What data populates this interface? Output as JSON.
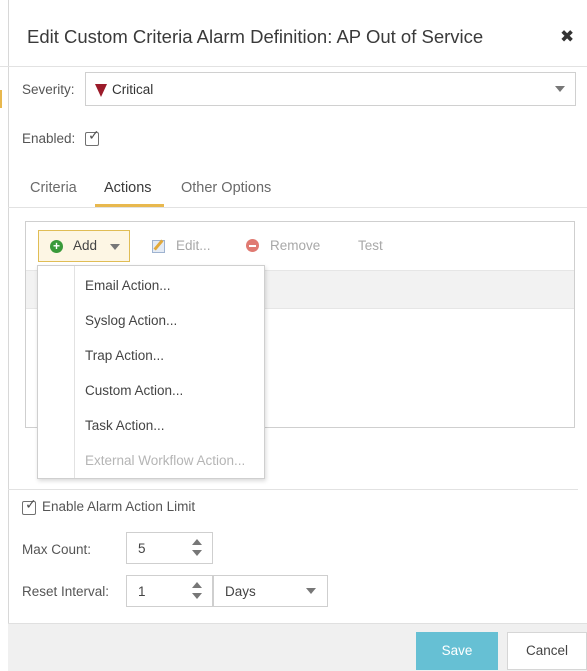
{
  "dialog": {
    "title": "Edit Custom Criteria Alarm Definition: AP Out of Service",
    "close_glyph": "✖"
  },
  "severity": {
    "label": "Severity:",
    "value": "Critical",
    "color": "#9b1b2a"
  },
  "enabled": {
    "label": "Enabled:",
    "checked": true
  },
  "tabs": [
    {
      "label": "Criteria",
      "active": false
    },
    {
      "label": "Actions",
      "active": true
    },
    {
      "label": "Other Options",
      "active": false
    }
  ],
  "toolbar": {
    "add_label": "Add",
    "edit_label": "Edit...",
    "remove_label": "Remove",
    "test_label": "Test"
  },
  "add_menu": {
    "items": [
      {
        "label": "Email Action...",
        "enabled": true
      },
      {
        "label": "Syslog Action...",
        "enabled": true
      },
      {
        "label": "Trap Action...",
        "enabled": true
      },
      {
        "label": "Custom Action...",
        "enabled": true
      },
      {
        "label": "Task Action...",
        "enabled": true
      },
      {
        "label": "External Workflow Action...",
        "enabled": false
      }
    ]
  },
  "alarm_limit": {
    "label": "Enable Alarm Action Limit",
    "checked": true,
    "max_count_label": "Max Count:",
    "max_count_value": "5",
    "reset_interval_label": "Reset Interval:",
    "reset_interval_value": "1",
    "reset_interval_unit": "Days"
  },
  "footer": {
    "save_label": "Save",
    "cancel_label": "Cancel"
  },
  "colors": {
    "accent": "#e8b84e",
    "save_button": "#66c0d4",
    "add_icon": "#3a9a3a",
    "remove_icon": "#e07a72"
  },
  "icons": {
    "close": "close-icon",
    "severity": "critical-triangle-icon",
    "add": "plus-circle-icon",
    "edit": "edit-pencil-icon",
    "remove": "minus-circle-icon",
    "dropdown": "chevron-down-icon",
    "spinner": "up-down-arrows-icon"
  }
}
